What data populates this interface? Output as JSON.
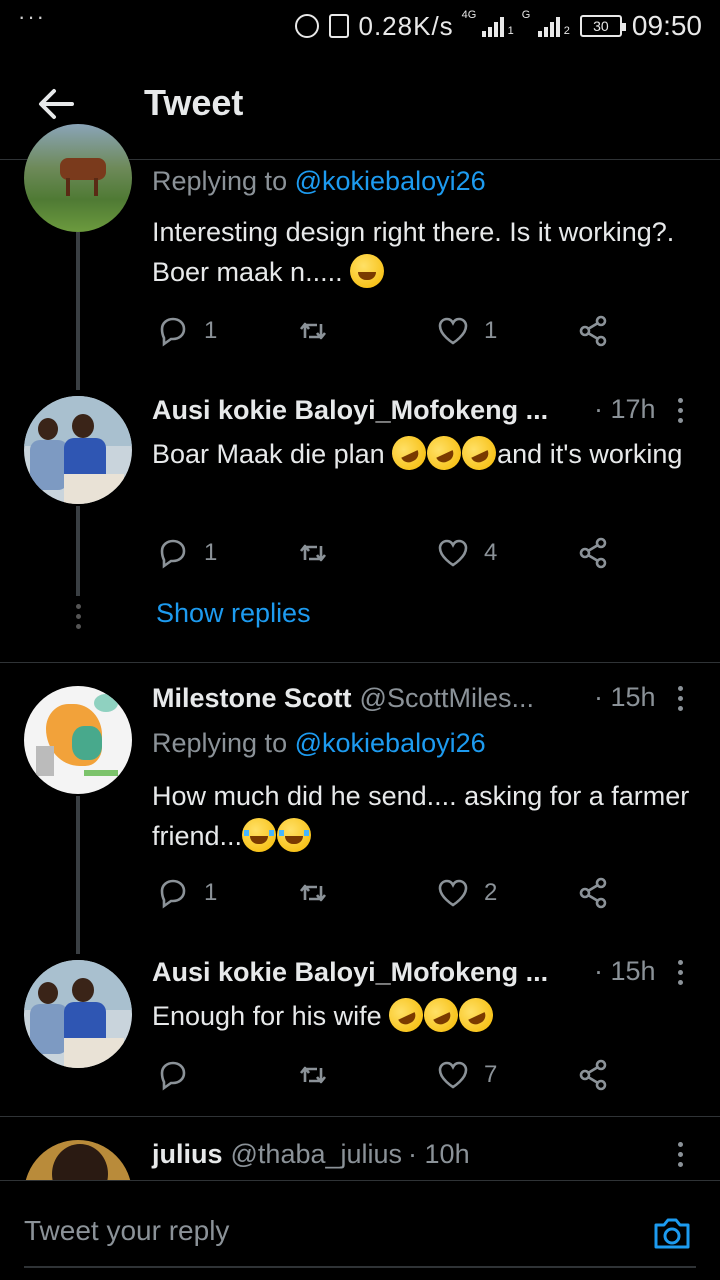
{
  "status_bar": {
    "menu_dots": "···",
    "speed": "0.28K/s",
    "net1": "4G",
    "sim1": "1",
    "net2": "G",
    "sim2": "2",
    "battery": "30",
    "time": "09:50"
  },
  "header": {
    "title": "Tweet"
  },
  "tweets": [
    {
      "replying_prefix": "Replying to",
      "replying_handle": "@kokiebaloyi26",
      "text": "Interesting design right there. Is it working?. Boer maak n..... ",
      "emojis": [
        "grin"
      ],
      "replies": "1",
      "likes": "1"
    },
    {
      "name": "Ausi kokie Baloyi_Mofokeng ...",
      "time": "· 17h",
      "text": "Boar Maak die plan ",
      "emojis": [
        "rofl",
        "rofl",
        "rofl"
      ],
      "text_after": "and it's working",
      "replies": "1",
      "likes": "4"
    },
    {
      "name": "Milestone Scott",
      "handle": "@ScottMiles...",
      "time": "· 15h",
      "replying_prefix": "Replying to",
      "replying_handle": "@kokiebaloyi26",
      "text": "How much did he send.... asking for a farmer friend...",
      "emojis": [
        "joy",
        "joy"
      ],
      "replies": "1",
      "likes": "2"
    },
    {
      "name": "Ausi kokie Baloyi_Mofokeng ...",
      "time": "· 15h",
      "text": "Enough for his wife ",
      "emojis": [
        "rofl",
        "rofl",
        "rofl"
      ],
      "replies": "",
      "likes": "7"
    },
    {
      "name": "julius",
      "handle": "@thaba_julius",
      "time": "· 10h"
    }
  ],
  "show_replies": "Show replies",
  "composer": {
    "placeholder": "Tweet your reply"
  },
  "colors": {
    "accent": "#1d9bf0",
    "background": "#000000",
    "muted": "#8b9298"
  }
}
